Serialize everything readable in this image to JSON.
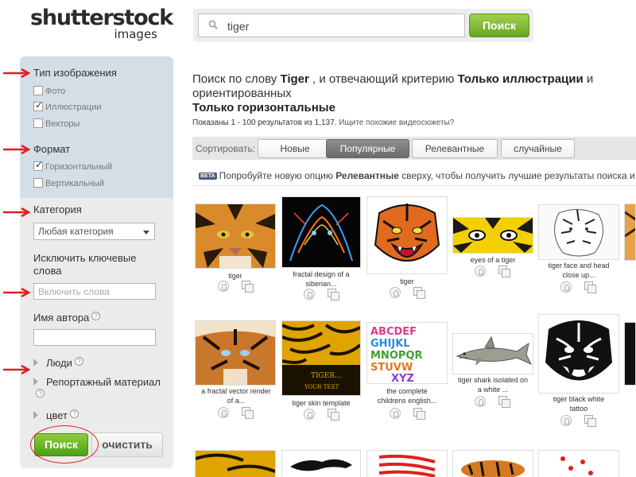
{
  "logo": {
    "main": "shutterstock",
    "sub": "images"
  },
  "search": {
    "value": "tiger",
    "button": "Поиск"
  },
  "sidebar": {
    "image_type_heading": "Тип изображения",
    "image_types": [
      {
        "label": "Фото",
        "checked": false
      },
      {
        "label": "Иллюстрации",
        "checked": true
      },
      {
        "label": "Векторы",
        "checked": false
      }
    ],
    "format_heading": "Формат",
    "formats": [
      {
        "label": "Горизонтальный",
        "checked": true
      },
      {
        "label": "Вертикальный",
        "checked": false
      }
    ],
    "category_heading": "Категория",
    "category_selected": "Любая категория",
    "exclude_label": "Исключить ключевые слова",
    "exclude_placeholder": "Включить слова",
    "author_label": "Имя автора",
    "people_label": "Люди",
    "editorial_label": "Репортажный материал",
    "color_label": "цвет",
    "search_button": "Поиск",
    "clear_button": "очистить"
  },
  "main": {
    "title_prefix": "Поиск по слову ",
    "title_term": "Tiger",
    "title_mid": " , и отвечающий критерию ",
    "title_crit1": "Только иллюстрации",
    "title_mid2": " и ориентированных",
    "title_crit2": "Только горизонтальные",
    "results_text": "Показаны 1 - 100 результатов из 1,137.",
    "video_link": "Ищите похожие видеосюжеты?",
    "sort_label": "Сортировать:",
    "sort_options": [
      "Новые",
      "Популярные",
      "Релевантные",
      "случайные"
    ],
    "sort_active": "Популярные",
    "beta_badge": "BETA",
    "beta_prefix": "Попробуйте новую опцию ",
    "beta_bold": "Релевантные",
    "beta_suffix": " сверху, чтобы получить лучшие результаты поиска и"
  },
  "thumbnails": [
    {
      "caption_l1": "tiger",
      "caption_l2": ""
    },
    {
      "caption_l1": "fractal design of a",
      "caption_l2": "siberian..."
    },
    {
      "caption_l1": "tiger",
      "caption_l2": ""
    },
    {
      "caption_l1": "eyes of a tiger",
      "caption_l2": ""
    },
    {
      "caption_l1": "tiger face and head",
      "caption_l2": "close up..."
    },
    {
      "caption_l1": "a fractal vector render",
      "caption_l2": "of a..."
    },
    {
      "caption_l1": "tiger skin template",
      "caption_l2": ""
    },
    {
      "caption_l1": "the complete",
      "caption_l2": "childrens english..."
    },
    {
      "caption_l1": "tiger shark isolated on",
      "caption_l2": "a white ..."
    },
    {
      "caption_l1": "tiger black white",
      "caption_l2": "tattoo"
    }
  ],
  "thumb_art": {
    "tiger_text_l1": "TIGER...",
    "tiger_text_l2": "YOUR TEXT",
    "alphabet_l1": "ABCDEF",
    "alphabet_l2": "GHIJKL",
    "alphabet_l3": "MNOPQR",
    "alphabet_l4": "STUVW",
    "alphabet_l5": "XYZ"
  },
  "colors": {
    "green": "#6aa525",
    "sidebar_top": "#d4dee7",
    "sidebar": "#ebebeb",
    "arrow": "#e02020"
  }
}
